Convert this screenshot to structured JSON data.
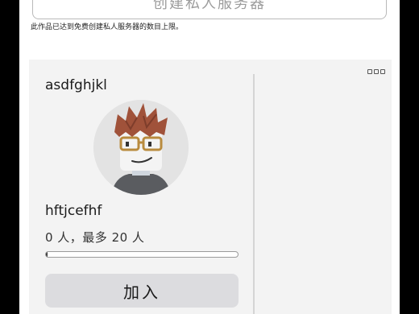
{
  "create_button": {
    "label": "创建私人服务器"
  },
  "limit_note": "此作品已达到免费创建私人服务器的数目上限。",
  "server_card": {
    "server_name": "asdfghjkl",
    "owner_name": "hftjcefhf",
    "capacity_text": "0 人，最多 20 人",
    "player_count": 0,
    "max_players": 20,
    "fill_fraction": 0.0,
    "join_label": "加入",
    "more_icon": "more-options-icon",
    "avatar_icon": "player-avatar"
  },
  "colors": {
    "background": "#000000",
    "panel": "#ffffff",
    "card": "#f3f3f3",
    "join_button": "#dcdcdf"
  }
}
